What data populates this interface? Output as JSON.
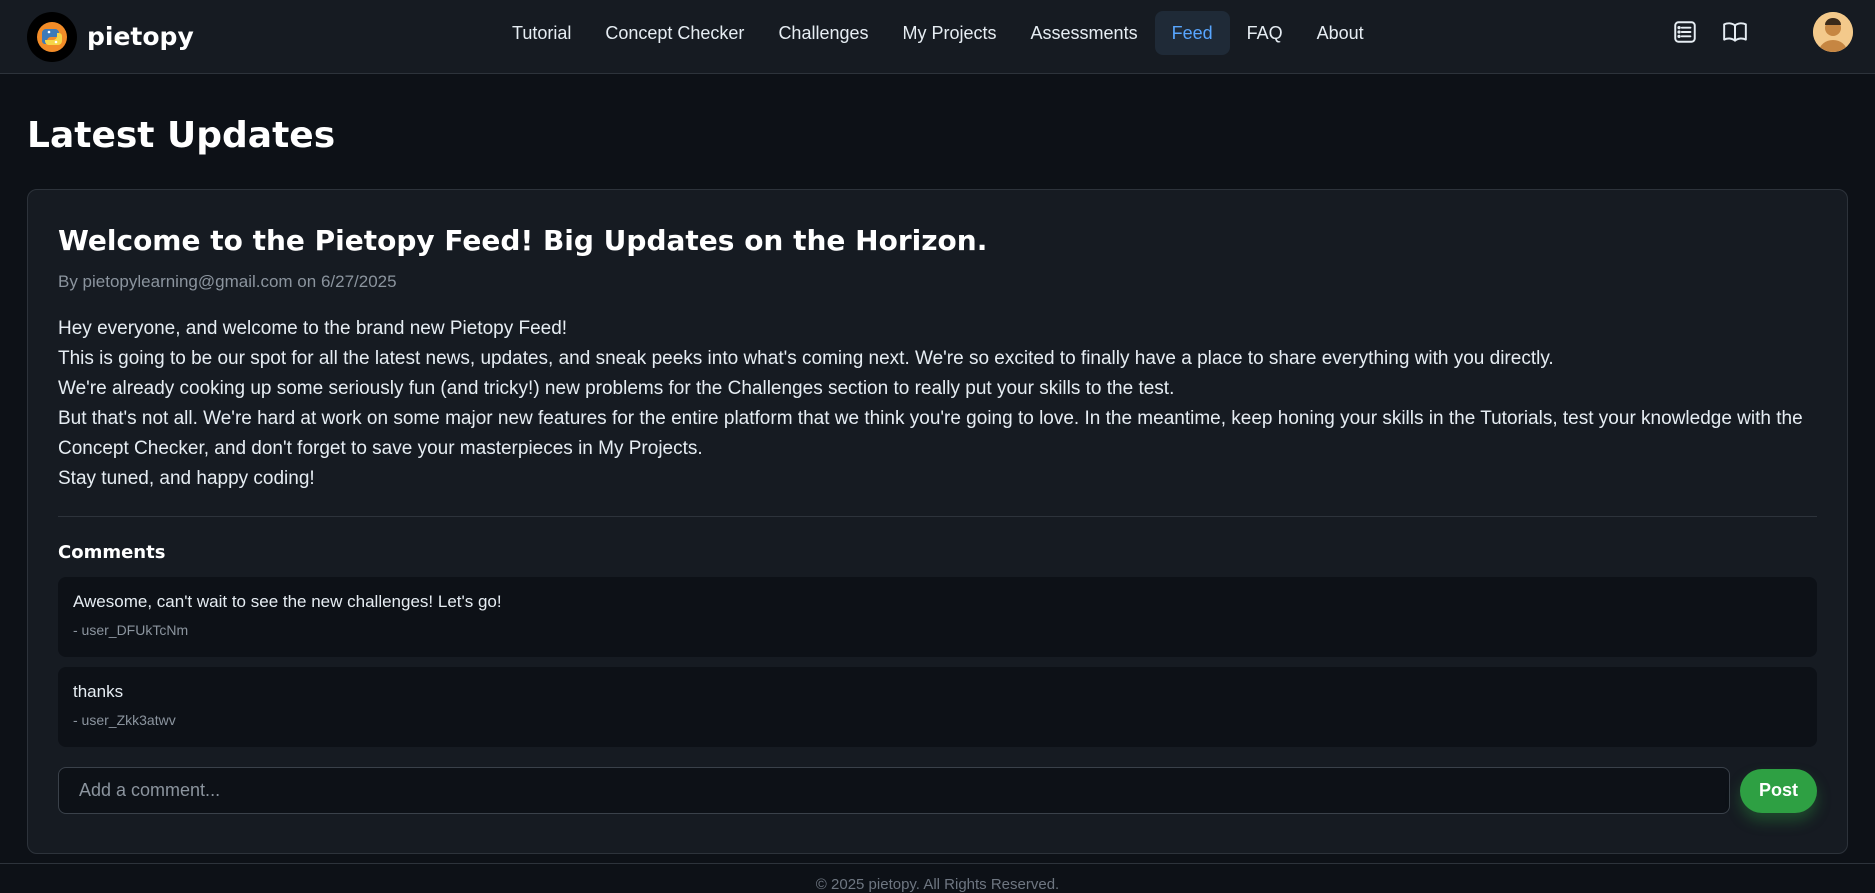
{
  "brand": {
    "name": "pietopy",
    "logo_icon": "python-logo-icon"
  },
  "nav": {
    "items": [
      {
        "label": "Tutorial",
        "active": false
      },
      {
        "label": "Concept Checker",
        "active": false
      },
      {
        "label": "Challenges",
        "active": false
      },
      {
        "label": "My Projects",
        "active": false
      },
      {
        "label": "Assessments",
        "active": false
      },
      {
        "label": "Feed",
        "active": true
      },
      {
        "label": "FAQ",
        "active": false
      },
      {
        "label": "About",
        "active": false
      }
    ],
    "active_color": "#58a6ff"
  },
  "header_icons": [
    "list-icon",
    "book-icon",
    "avatar"
  ],
  "page": {
    "title": "Latest Updates"
  },
  "post": {
    "title": "Welcome to the Pietopy Feed! Big Updates on the Horizon.",
    "meta": "By pietopylearning@gmail.com on 6/27/2025",
    "paragraphs": [
      "Hey everyone, and welcome to the brand new Pietopy Feed!",
      "This is going to be our spot for all the latest news, updates, and sneak peeks into what's coming next. We're so excited to finally have a place to share everything with you directly.",
      "We're already cooking up some seriously fun (and tricky!) new problems for the Challenges section to really put your skills to the test.",
      "But that's not all. We're hard at work on some major new features for the entire platform that we think you're going to love. In the meantime, keep honing your skills in the Tutorials, test your knowledge with the Concept Checker, and don't forget to save your masterpieces in My Projects.",
      "Stay tuned, and happy coding!"
    ]
  },
  "comments": {
    "heading": "Comments",
    "items": [
      {
        "text": "Awesome, can't wait to see the new challenges! Let's go!",
        "author": "- user_DFUkTcNm"
      },
      {
        "text": "thanks",
        "author": "- user_Zkk3atwv"
      }
    ],
    "input_placeholder": "Add a comment...",
    "post_label": "Post",
    "post_color": "#2ea043"
  },
  "footer": {
    "text": "© 2025 pietopy. All Rights Reserved."
  }
}
